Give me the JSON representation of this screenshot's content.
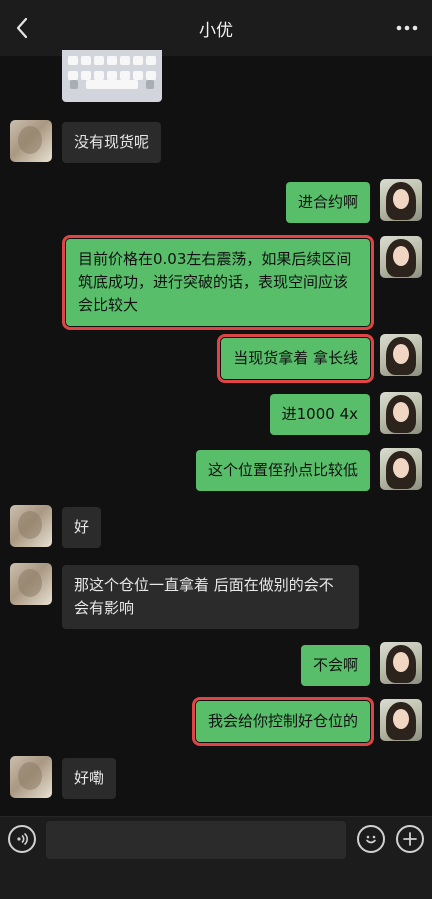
{
  "header": {
    "title": "小优"
  },
  "messages": [
    {
      "id": "m1",
      "side": "in",
      "text": "没有现货呢"
    },
    {
      "id": "m2",
      "side": "out",
      "text": "进合约啊"
    },
    {
      "id": "m3",
      "side": "out",
      "text": "目前价格在0.03左右震荡，如果后续区间筑底成功，进行突破的话，表现空间应该会比较大",
      "highlighted": true
    },
    {
      "id": "m4",
      "side": "out",
      "text": "当现货拿着 拿长线",
      "highlighted": true
    },
    {
      "id": "m5",
      "side": "out",
      "text": "进1000 4x"
    },
    {
      "id": "m6",
      "side": "out",
      "text": "这个位置侄孙点比较低"
    },
    {
      "id": "m7",
      "side": "in",
      "text": "好"
    },
    {
      "id": "m8",
      "side": "in",
      "text": "那这个仓位一直拿着 后面在做别的会不会有影响"
    },
    {
      "id": "m9",
      "side": "out",
      "text": "不会啊"
    },
    {
      "id": "m10",
      "side": "out",
      "text": "我会给你控制好仓位的",
      "highlighted": true
    },
    {
      "id": "m11",
      "side": "in",
      "text": "好嘞"
    }
  ],
  "icons": {
    "back": "chevron-left-icon",
    "more": "more-dots-icon",
    "voice": "voice-icon",
    "emoji": "emoji-icon",
    "plus": "plus-icon"
  },
  "colors": {
    "background": "#111111",
    "bar": "#1c1c1c",
    "incoming_bubble": "#2b2b2b",
    "outgoing_bubble": "#58be6a",
    "highlight": "#e04545"
  }
}
